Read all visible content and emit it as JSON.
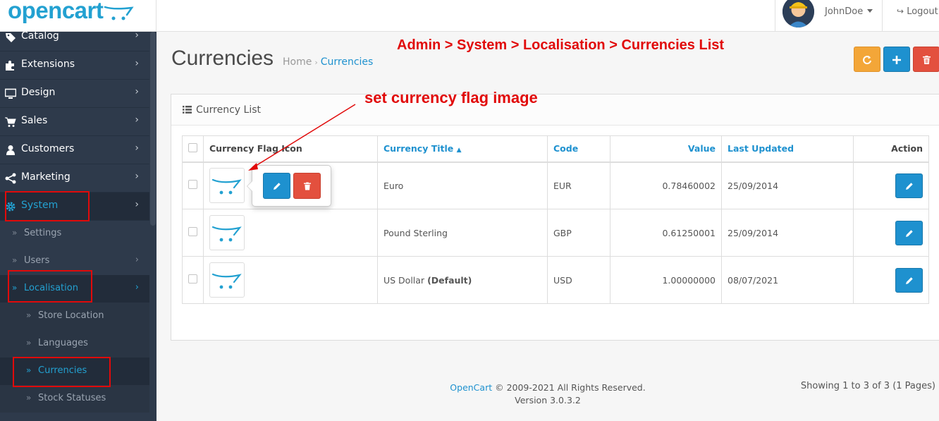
{
  "header": {
    "logo_text": "opencart",
    "user_name": "JohnDoe",
    "logout_label": "Logout"
  },
  "sidebar": {
    "items": [
      {
        "label": "Catalog",
        "icon": "tag-icon"
      },
      {
        "label": "Extensions",
        "icon": "puzzle-icon"
      },
      {
        "label": "Design",
        "icon": "monitor-icon"
      },
      {
        "label": "Sales",
        "icon": "cart-icon"
      },
      {
        "label": "Customers",
        "icon": "user-icon"
      },
      {
        "label": "Marketing",
        "icon": "share-icon"
      },
      {
        "label": "System",
        "icon": "gear-icon"
      }
    ],
    "system_sub": [
      {
        "label": "Settings"
      },
      {
        "label": "Users"
      },
      {
        "label": "Localisation"
      }
    ],
    "localisation_sub": [
      {
        "label": "Store Location"
      },
      {
        "label": "Languages"
      },
      {
        "label": "Currencies"
      },
      {
        "label": "Stock Statuses"
      }
    ]
  },
  "page": {
    "title": "Currencies",
    "breadcrumb": [
      {
        "label": "Home"
      },
      {
        "label": "Currencies"
      }
    ]
  },
  "annotations": {
    "path": "Admin > System > Localisation > Currencies List",
    "flag": "set currency flag image"
  },
  "toolbar": {
    "refresh_color": "#f3a638",
    "add_color": "#1e91cf",
    "delete_color": "#e3503e"
  },
  "panel": {
    "title": "Currency List"
  },
  "table": {
    "headers": {
      "flag": "Currency Flag Icon",
      "title": "Currency Title",
      "code": "Code",
      "value": "Value",
      "updated": "Last Updated",
      "action": "Action"
    },
    "rows": [
      {
        "title": "Euro",
        "title_suffix": "",
        "code": "EUR",
        "value": "0.78460002",
        "updated": "25/09/2014"
      },
      {
        "title": "Pound Sterling",
        "title_suffix": "",
        "code": "GBP",
        "value": "0.61250001",
        "updated": "25/09/2014"
      },
      {
        "title": "US Dollar ",
        "title_suffix": "(Default)",
        "code": "USD",
        "value": "1.00000000",
        "updated": "08/07/2021"
      }
    ]
  },
  "pagination": {
    "text": "Showing 1 to 3 of 3 (1 Pages)"
  },
  "footer": {
    "brand": "OpenCart",
    "copyright": " © 2009-2021 All Rights Reserved.",
    "version": "Version 3.0.3.2"
  },
  "colors": {
    "accent": "#1e91cf",
    "sidebar_bg": "#2e3a4b",
    "annotation": "#e10a0a"
  }
}
